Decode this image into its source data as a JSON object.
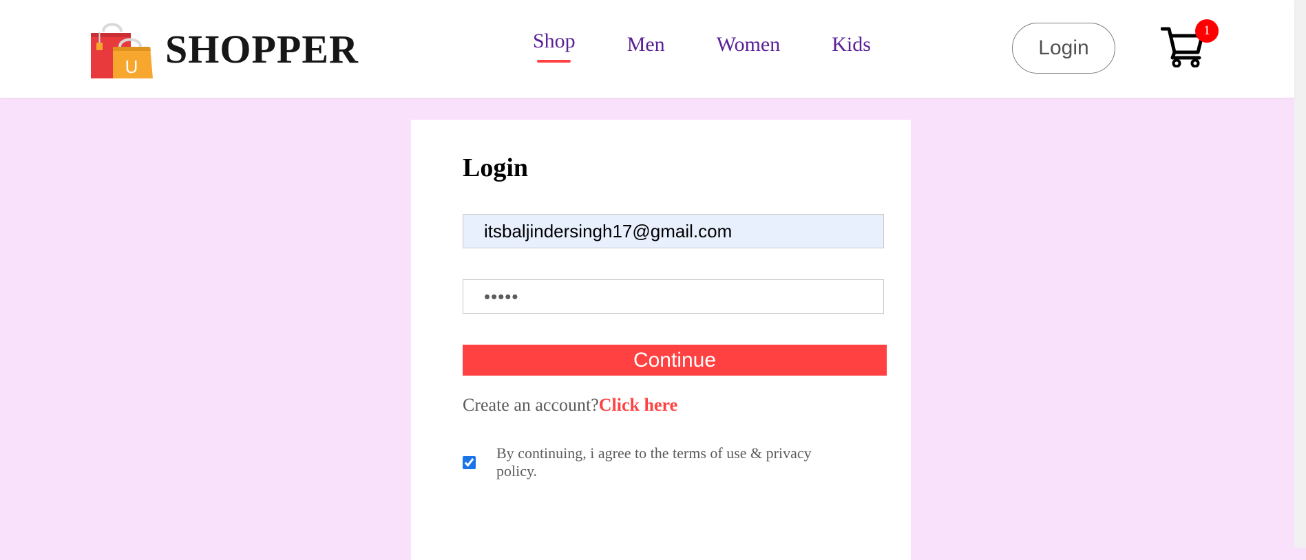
{
  "brand": {
    "name": "SHOPPER",
    "logo_letter": "U",
    "colors": {
      "accent": "#ff4141",
      "nav_text": "#5a2096",
      "page_bg": "#fae1fb",
      "bag_red": "#e8393d",
      "bag_yellow": "#f7a72e"
    }
  },
  "nav": {
    "items": [
      {
        "label": "Shop",
        "active": true
      },
      {
        "label": "Men",
        "active": false
      },
      {
        "label": "Women",
        "active": false
      },
      {
        "label": "Kids",
        "active": false
      }
    ],
    "login_label": "Login",
    "cart_icon": "cart-icon",
    "cart_count": "1"
  },
  "login": {
    "title": "Login",
    "email_value": "itsbaljindersingh17@gmail.com",
    "password_value": "•••••",
    "continue_label": "Continue",
    "create_prompt": "Create an account?",
    "create_link": "Click here",
    "agree_checked": true,
    "agree_text": "By continuing, i agree to the terms of use & privacy policy."
  }
}
